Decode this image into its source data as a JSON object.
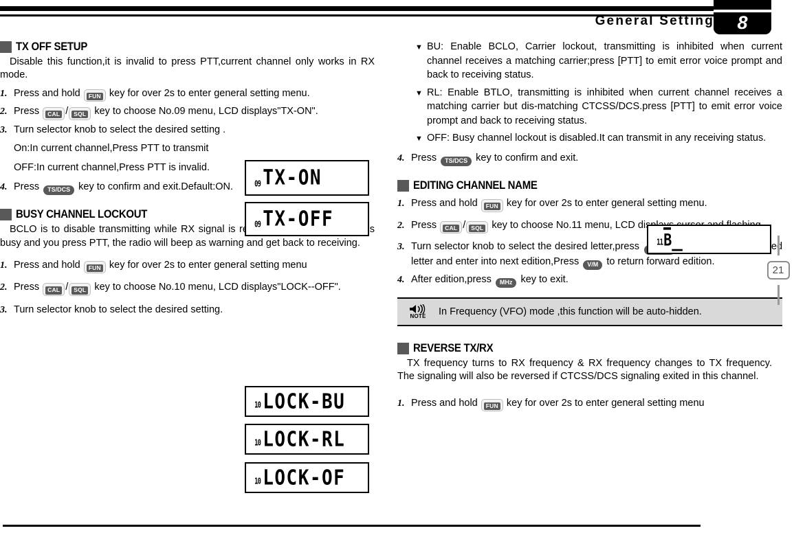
{
  "header": {
    "title": "General Setting",
    "chapter": "8"
  },
  "page_tab": {
    "number": "21"
  },
  "left_column": {
    "section_tx_off": {
      "heading": "TX OFF SETUP",
      "intro": "Disable this function,it is invalid to press PTT,current channel only works in RX mode.",
      "steps": [
        {
          "num": "1.",
          "pre": "Press and hold",
          "key1": "FUN",
          "post": "key for over 2s to enter general setting menu."
        },
        {
          "num": "2.",
          "pre": "Press",
          "key1": "CAL",
          "sep": "/",
          "key2": "SQL",
          "post": "key to choose No.09 menu, LCD displays\"TX-ON\"."
        },
        {
          "num": "3.",
          "pre": "Turn selector knob to select the desired setting .",
          "sub1": "On:In current channel,Press PTT to transmit",
          "sub2": "OFF:In current channel,Press PTT is invalid."
        },
        {
          "num": "4.",
          "pre": "Press",
          "key1": "TS/DCS",
          "post": "key to confirm and exit.Default:ON."
        }
      ],
      "lcds": [
        {
          "index": "09",
          "text": "TX-ON"
        },
        {
          "index": "09",
          "text": "TX-OFF"
        }
      ]
    },
    "section_busy_lockout": {
      "heading": "BUSY CHANNEL LOCKOUT",
      "intro": "BCLO is to disable transmitting while RX signal is received. Once the channel is busy and you press PTT, the radio will beep as warning and get back to receiving.",
      "steps": [
        {
          "num": "1.",
          "pre": "Press and hold",
          "key1": "FUN",
          "post": "key for over 2s to enter general setting menu"
        },
        {
          "num": "2.",
          "pre": "Press",
          "key1": "CAL",
          "sep": "/",
          "key2": "SQL",
          "post": "key to choose No.10 menu, LCD displays\"LOCK--OFF\"."
        },
        {
          "num": "3.",
          "pre": "Turn selector knob to select the desired setting."
        }
      ],
      "lcds": [
        {
          "index": "10",
          "text": "LOCK-BU"
        },
        {
          "index": "10",
          "text": "LOCK-RL"
        },
        {
          "index": "10",
          "text": "LOCK-OF"
        }
      ]
    }
  },
  "right_column": {
    "lockout_options": [
      {
        "marker": "▼",
        "text": "BU: Enable BCLO, Carrier lockout, transmitting is inhibited when current channel receives a matching carrier;press [PTT] to emit error voice prompt and back to receiving status."
      },
      {
        "marker": "▼",
        "text": "RL: Enable BTLO, transmitting is inhibited when current channel receives a matching carrier but dis-matching CTCSS/DCS.press [PTT] to emit error voice prompt and back to receiving status."
      },
      {
        "marker": "▼",
        "text": "OFF: Busy channel lockout is disabled.It can transmit in any receiving status."
      }
    ],
    "lockout_step4": {
      "num": "4.",
      "pre": "Press",
      "key1": "TS/DCS",
      "post": "key to confirm and exit."
    },
    "section_editing_name": {
      "heading": "EDITING CHANNEL NAME",
      "steps": [
        {
          "num": "1.",
          "pre": "Press and hold",
          "key1": "FUN",
          "post": "key for over 2s to enter general setting menu."
        },
        {
          "num": "2.",
          "pre": "Press",
          "key1": "CAL",
          "sep": "/",
          "key2": "SQL",
          "post": "key to choose No.11 menu, LCD displays cursor and flashing."
        },
        {
          "num": "3.",
          "pre": "Turn selector knob to select the desired letter,press",
          "key1": "TS/DCS",
          "mid": "key to confirm selected letter and enter into next edition,Press",
          "key2": "V/M",
          "post": "to return forward edition."
        },
        {
          "num": "4.",
          "pre": "After edition,press",
          "key1": "MHz",
          "post": "key to exit."
        }
      ],
      "lcd": {
        "index": "11",
        "letter": "B",
        "cursor": "_"
      }
    },
    "note": {
      "icon": "speaker-note-icon",
      "label": "NOTE",
      "text": "In Frequency (VFO) mode ,this function will be auto-hidden."
    },
    "section_reverse": {
      "heading": "REVERSE TX/RX",
      "intro": "TX frequency turns to RX frequency & RX frequency changes to TX frequency. The signaling will also be reversed if  CTCSS/DCS signaling exited in this channel.",
      "steps": [
        {
          "num": "1.",
          "pre": "Press and hold",
          "key1": "FUN",
          "post": "key for over 2s to enter general setting menu"
        }
      ]
    }
  },
  "colors": {
    "section_square": "#595959",
    "key_cap": "#595959",
    "note_bg": "#d9d9d9",
    "page_tab_border": "#8c8c8c"
  }
}
